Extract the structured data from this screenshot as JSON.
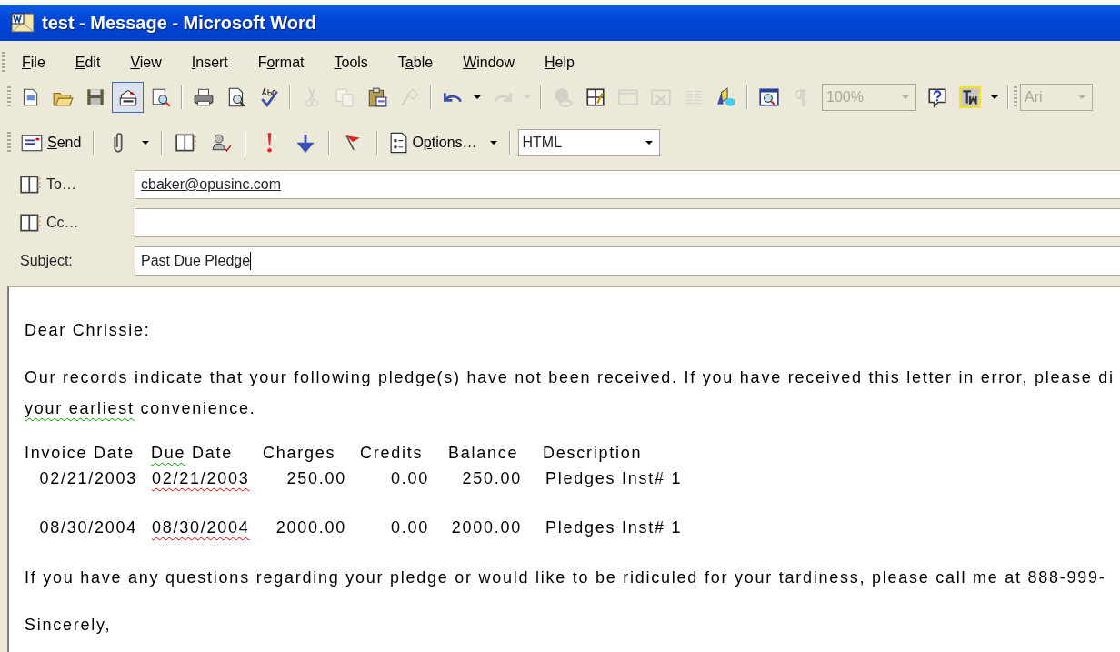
{
  "window": {
    "title": "test - Message - Microsoft Word"
  },
  "menu": [
    {
      "key": "F",
      "post": "ile"
    },
    {
      "key": "E",
      "post": "dit"
    },
    {
      "key": "V",
      "post": "iew"
    },
    {
      "key": "I",
      "post": "nsert"
    },
    {
      "pre": "F",
      "key": "o",
      "post": "rmat"
    },
    {
      "key": "T",
      "post": "ools"
    },
    {
      "pre": "T",
      "key": "a",
      "post": "ble"
    },
    {
      "key": "W",
      "post": "indow"
    },
    {
      "key": "H",
      "post": "elp"
    }
  ],
  "standard_toolbar": {
    "buttons": [
      {
        "pressed": false,
        "disabled": false
      },
      {
        "pressed": false,
        "disabled": false
      },
      {
        "pressed": false,
        "disabled": false
      },
      {
        "pressed": true,
        "disabled": false
      },
      {
        "pressed": false,
        "disabled": false
      },
      {
        "pressed": false,
        "disabled": false
      },
      {
        "pressed": false,
        "disabled": false
      },
      {
        "pressed": false,
        "disabled": false
      },
      {
        "pressed": false,
        "disabled": true
      },
      {
        "pressed": false,
        "disabled": true
      },
      {
        "pressed": false,
        "disabled": false
      },
      {
        "pressed": false,
        "disabled": true
      },
      {
        "pressed": false,
        "disabled": false
      },
      {
        "pressed": false,
        "disabled": false
      },
      {
        "pressed": false,
        "disabled": true
      },
      {
        "pressed": false,
        "disabled": true
      },
      {
        "pressed": false,
        "disabled": true
      },
      {
        "pressed": false,
        "disabled": false
      },
      {
        "pressed": false,
        "disabled": true
      },
      {
        "pressed": false,
        "disabled": true
      },
      {
        "pressed": false,
        "disabled": true
      },
      {
        "pressed": false,
        "disabled": false
      },
      {
        "pressed": false,
        "disabled": false
      },
      {
        "pressed": false,
        "disabled": true
      },
      {
        "pressed": false,
        "disabled": false
      },
      {
        "pressed": false,
        "disabled": false
      },
      {
        "pressed": false,
        "disabled": false
      }
    ],
    "zoom": {
      "value": "100%",
      "disabled": true
    },
    "font": {
      "value": "Ari",
      "disabled": true
    }
  },
  "email_toolbar": {
    "send": {
      "key": "S",
      "post": "end"
    },
    "options": {
      "pre": "O",
      "key": "p",
      "post": "tions…"
    },
    "format": {
      "value": "HTML"
    }
  },
  "fields": [
    {
      "label": "To…",
      "address_book": true,
      "value": "cbaker@opusinc.com",
      "resolved": true,
      "cursor": false
    },
    {
      "label": "Cc…",
      "address_book": true,
      "cursor": false
    },
    {
      "label": "Subject:",
      "address_book": false,
      "value": "Past Due Pledge",
      "resolved": false,
      "cursor": true
    }
  ],
  "body": [
    {
      "kind": "paragraph",
      "lines": [
        [
          {
            "text": "Dear Chrissie:",
            "spelling": false,
            "grammar": false
          }
        ]
      ]
    },
    {
      "kind": "paragraph",
      "lines": [
        [
          {
            "text": "Our records indicate that your following pledge(s) have not been received.  If you have received this letter in error, please di",
            "spelling": false,
            "grammar": false
          }
        ],
        [
          {
            "text": "your  earliest",
            "spelling": false,
            "grammar": true
          },
          {
            "text": " convenience.",
            "spelling": false,
            "grammar": false
          }
        ]
      ]
    },
    {
      "kind": "table",
      "header": [
        [
          {
            "text": "Invoice Date",
            "spelling": false,
            "grammar": false
          }
        ],
        [
          {
            "text": "Due",
            "spelling": false,
            "grammar": true
          },
          {
            "text": " Date",
            "spelling": false,
            "grammar": false
          }
        ],
        [
          {
            "text": "Charges",
            "spelling": false,
            "grammar": false
          }
        ],
        [
          {
            "text": "Credits",
            "spelling": false,
            "grammar": false
          }
        ],
        [
          {
            "text": "Balance",
            "spelling": false,
            "grammar": false
          }
        ],
        [
          {
            "text": "Description",
            "spelling": false,
            "grammar": false
          }
        ]
      ],
      "rows": [
        [
          [
            {
              "text": "02/21/2003",
              "spelling": false,
              "grammar": false
            }
          ],
          [
            {
              "text": "02/21/2003",
              "spelling": true,
              "grammar": false
            }
          ],
          [
            {
              "text": "250.00",
              "spelling": false,
              "grammar": false
            }
          ],
          [
            {
              "text": "0.00",
              "spelling": false,
              "grammar": false
            }
          ],
          [
            {
              "text": "250.00",
              "spelling": false,
              "grammar": false
            }
          ],
          [
            {
              "text": "Pledges Inst# 1",
              "spelling": false,
              "grammar": false
            }
          ]
        ],
        [
          [
            {
              "text": "08/30/2004",
              "spelling": false,
              "grammar": false
            }
          ],
          [
            {
              "text": "08/30/2004",
              "spelling": true,
              "grammar": false
            }
          ],
          [
            {
              "text": "2000.00",
              "spelling": false,
              "grammar": false
            }
          ],
          [
            {
              "text": "0.00",
              "spelling": false,
              "grammar": false
            }
          ],
          [
            {
              "text": "2000.00",
              "spelling": false,
              "grammar": false
            }
          ],
          [
            {
              "text": "Pledges Inst# 1",
              "spelling": false,
              "grammar": false
            }
          ]
        ]
      ]
    },
    {
      "kind": "paragraph",
      "lines": [
        [
          {
            "text": "If you have any questions regarding your pledge or would like to be ridiculed for your tardiness, please call me at 888-999-",
            "spelling": false,
            "grammar": false
          }
        ]
      ]
    },
    {
      "kind": "paragraph",
      "lines": [
        [
          {
            "text": "Sincerely,",
            "spelling": false,
            "grammar": false
          }
        ]
      ]
    }
  ]
}
